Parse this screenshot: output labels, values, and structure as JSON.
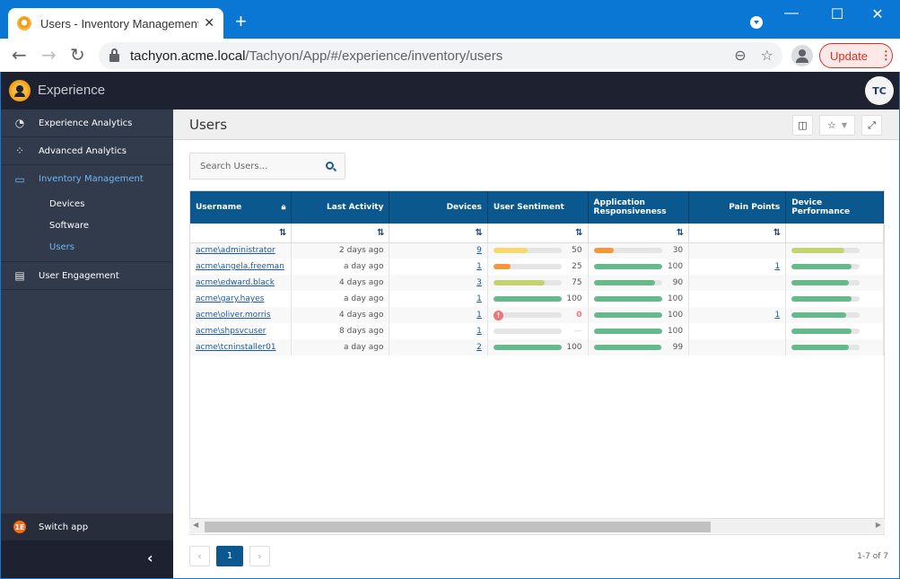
{
  "browser": {
    "tab_title": "Users - Inventory Management - ",
    "url_host": "tachyon.acme.local",
    "url_path": "/Tachyon/App/#/experience/inventory/users",
    "update_label": "Update"
  },
  "app": {
    "name": "Experience",
    "user_initials": "TC"
  },
  "sidebar": {
    "items": [
      {
        "label": "Experience Analytics",
        "icon": "speedometer-icon"
      },
      {
        "label": "Advanced Analytics",
        "icon": "binoculars-icon"
      },
      {
        "label": "Inventory Management",
        "icon": "monitor-icon",
        "active": true
      },
      {
        "label": "User Engagement",
        "icon": "clipboard-icon"
      }
    ],
    "sub_items": [
      {
        "label": "Devices"
      },
      {
        "label": "Software"
      },
      {
        "label": "Users",
        "active": true
      }
    ],
    "switch_app": "Switch app"
  },
  "page": {
    "title": "Users",
    "search_placeholder": "Search Users..."
  },
  "table": {
    "columns": [
      "Username",
      "Last Activity",
      "Devices",
      "User Sentiment",
      "Application Responsiveness",
      "Pain Points",
      "Device Performance"
    ],
    "rows": [
      {
        "username": "acme\\administrator",
        "last_activity": "2 days ago",
        "devices": "9",
        "sentiment": 50,
        "sentiment_label": "50",
        "app_resp": 30,
        "app_resp_label": "30",
        "pain_points": "",
        "device_perf": 77
      },
      {
        "username": "acme\\angela.freeman",
        "last_activity": "a day ago",
        "devices": "1",
        "sentiment": 25,
        "sentiment_label": "25",
        "app_resp": 100,
        "app_resp_label": "100",
        "pain_points": "1",
        "device_perf": 88
      },
      {
        "username": "acme\\edward.black",
        "last_activity": "4 days ago",
        "devices": "3",
        "sentiment": 75,
        "sentiment_label": "75",
        "app_resp": 90,
        "app_resp_label": "90",
        "pain_points": "",
        "device_perf": 84
      },
      {
        "username": "acme\\gary.hayes",
        "last_activity": "a day ago",
        "devices": "1",
        "sentiment": 100,
        "sentiment_label": "100",
        "app_resp": 100,
        "app_resp_label": "100",
        "pain_points": "",
        "device_perf": 88
      },
      {
        "username": "acme\\oliver.morris",
        "last_activity": "4 days ago",
        "devices": "1",
        "sentiment": 0,
        "sentiment_label": "0",
        "sentiment_alert": true,
        "app_resp": 100,
        "app_resp_label": "100",
        "pain_points": "1",
        "device_perf": 80
      },
      {
        "username": "acme\\shpsvcuser",
        "last_activity": "8 days ago",
        "devices": "1",
        "sentiment": null,
        "sentiment_label": "—",
        "app_resp": 100,
        "app_resp_label": "100",
        "pain_points": "",
        "device_perf": 88
      },
      {
        "username": "acme\\tcninstaller01",
        "last_activity": "a day ago",
        "devices": "2",
        "sentiment": 100,
        "sentiment_label": "100",
        "app_resp": 99,
        "app_resp_label": "99",
        "pain_points": "",
        "device_perf": 84
      }
    ]
  },
  "colors": {
    "header_blue": "#0b588f",
    "green": "#66b98a",
    "yellow": "#f7d86e",
    "orange": "#f4963a",
    "lime": "#c3d36e",
    "alert_red": "#ec7474"
  },
  "pagination": {
    "current_page": "1",
    "summary": "1-7 of 7"
  }
}
